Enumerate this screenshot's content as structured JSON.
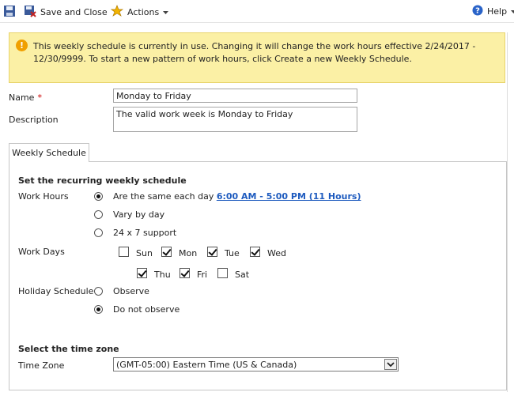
{
  "toolbar": {
    "save_icon": "save-icon",
    "save_close_label": "Save and Close",
    "actions_label": "Actions",
    "help_label": "Help"
  },
  "notification": {
    "icon": "warning-icon",
    "message": "This weekly schedule is currently in use. Changing it will change the work hours effective 2/24/2017 - 12/30/9999. To start a new pattern of work hours, click Create a new Weekly Schedule."
  },
  "form": {
    "name_label": "Name",
    "required_marker": "*",
    "name_value": "Monday to Friday",
    "description_label": "Description",
    "description_value": "The valid work week is Monday to Friday"
  },
  "tab": {
    "label": "Weekly Schedule"
  },
  "schedule": {
    "section_title": "Set the recurring weekly schedule",
    "work_hours_label": "Work Hours",
    "work_hours_options": [
      {
        "label": "Are the same each day",
        "selected": true
      },
      {
        "label": "Vary by day",
        "selected": false
      },
      {
        "label": "24 x 7 support",
        "selected": false
      }
    ],
    "hours_link": "6:00 AM - 5:00 PM (11 Hours)",
    "work_days_label": "Work Days",
    "days": [
      {
        "label": "Sun",
        "checked": false
      },
      {
        "label": "Mon",
        "checked": true
      },
      {
        "label": "Tue",
        "checked": true
      },
      {
        "label": "Wed",
        "checked": true
      },
      {
        "label": "Thu",
        "checked": true
      },
      {
        "label": "Fri",
        "checked": true
      },
      {
        "label": "Sat",
        "checked": false
      }
    ],
    "holiday_label": "Holiday Schedule",
    "holiday_options": [
      {
        "label": "Observe",
        "selected": false
      },
      {
        "label": "Do not observe",
        "selected": true
      }
    ]
  },
  "timezone": {
    "section_title": "Select the time zone",
    "label": "Time Zone",
    "value": "(GMT-05:00) Eastern Time (US & Canada)"
  },
  "colors": {
    "notification_bg": "#fbf0a5",
    "link": "#1e5bbf",
    "required": "#cc0000"
  }
}
